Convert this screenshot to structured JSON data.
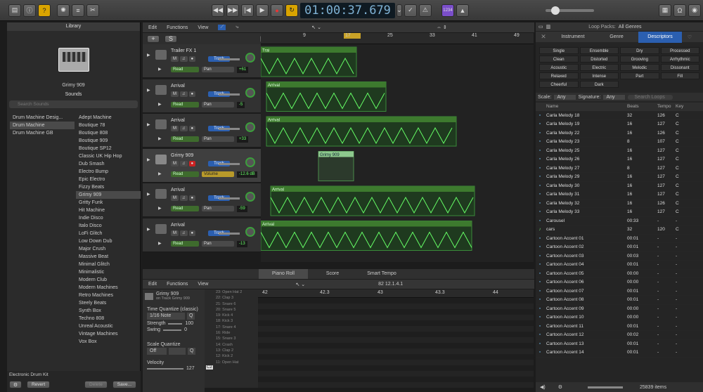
{
  "control_bar": {
    "lcd_time": "01:00:37.679",
    "badge": "1234"
  },
  "library": {
    "title": "Library",
    "patch_name": "Grimy 909",
    "sounds_label": "Sounds",
    "search_placeholder": "Search Sounds",
    "categories": [
      "Drum Machine Desig...",
      "Drum Machine",
      "Drum Machine GB"
    ],
    "patches": [
      "Adept Machine",
      "Boutique 78",
      "Boutique 808",
      "Boutique 909",
      "Boutique SP12",
      "Classic UK Hip Hop",
      "Dub Smash",
      "Electro Bump",
      "Epic Electro",
      "Fizzy Beats",
      "Grimy 909",
      "Gritty Funk",
      "Hit Machine",
      "Indie Disco",
      "Italo Disco",
      "LoFi Glitch",
      "Low Down Dub",
      "Major Crush",
      "Massive Beat",
      "Minimal Glitch",
      "Minimalistic",
      "Modern Club",
      "Modern Machines",
      "Retro Machines",
      "Steely Beats",
      "Synth Box",
      "Techno 808",
      "Unreal Acoustic",
      "Vintage Machines",
      "Vox Box"
    ],
    "footer_kit": "Electronic Drum Kit",
    "revert": "Revert",
    "delete": "Delete",
    "save": "Save..."
  },
  "tracks_menu": {
    "edit": "Edit",
    "functions": "Functions",
    "view": "View"
  },
  "ruler": [
    "9",
    "17",
    "25",
    "33",
    "41",
    "49"
  ],
  "tracks": [
    {
      "name": "Trailer FX 1",
      "mode": "Read",
      "param": "Pan",
      "value": "+61",
      "btn": "Track"
    },
    {
      "name": "Arrival",
      "mode": "Read",
      "param": "Pan",
      "value": "-5",
      "btn": "Track"
    },
    {
      "name": "Arrival",
      "mode": "Read",
      "param": "Pan",
      "value": "+33",
      "btn": "Track"
    },
    {
      "name": "Grimy 909",
      "mode": "Read",
      "param": "Volume",
      "value": "-12.6 dB",
      "btn": "Track"
    },
    {
      "name": "Arrival",
      "mode": "Read",
      "param": "Pan",
      "value": "-59",
      "btn": "Track"
    },
    {
      "name": "Arrival",
      "mode": "Read",
      "param": "Pan",
      "value": "-13",
      "btn": "Track"
    }
  ],
  "regions": {
    "trailer": "Trai",
    "arrival": "Arrival",
    "grimy": "Grimy 909"
  },
  "editor": {
    "tabs": [
      "Piano Roll",
      "Score",
      "Smart Tempo"
    ],
    "edit": "Edit",
    "functions": "Functions",
    "view": "View",
    "position": "82  12.1.4.1",
    "ruler": [
      "42",
      "42.3",
      "43",
      "43.3",
      "44"
    ],
    "region_name": "Grimy 909",
    "region_sub": "on Track Grimy 909",
    "tq_label": "Time Quantize (classic)",
    "tq_value": "1/16 Note",
    "q": "Q",
    "strength_label": "Strength",
    "strength_value": "100",
    "swing_label": "Swing",
    "swing_value": "0",
    "sq_label": "Scale Quantize",
    "sq_value": "Off",
    "velocity_label": "Velocity",
    "velocity_value": "127",
    "keys": [
      "23: Open Hat 2",
      "22: Clap 3",
      "21: Snare 6",
      "20: Snare 5",
      "19: Kick 4",
      "18: Kick 3",
      "17: Snare 4",
      "16: Ride",
      "15: Snare 3",
      "14: Crash",
      "13: Clap 2",
      "12: Kick 2",
      "11: Open Hat"
    ],
    "c2": "C2"
  },
  "loops": {
    "packs_label": "Loop Packs:",
    "packs_value": "All Genres",
    "tabs": [
      "Instrument",
      "Genre",
      "Descriptors"
    ],
    "descriptors": [
      [
        "Single",
        "Ensemble",
        "Dry",
        "Processed"
      ],
      [
        "Clean",
        "Distorted",
        "Grooving",
        "Arrhythmic"
      ],
      [
        "Acoustic",
        "Electric",
        "Melodic",
        "Dissonant"
      ],
      [
        "Relaxed",
        "Intense",
        "Part",
        "Fill"
      ],
      [
        "Cheerful",
        "Dark",
        "",
        ""
      ]
    ],
    "scale_label": "Scale:",
    "scale_value": "Any",
    "signature_label": "Signature:",
    "signature_value": "Any",
    "search_placeholder": "Search Loops",
    "columns": [
      "Name",
      "Beats",
      "Tempo",
      "Key"
    ],
    "rows": [
      [
        "Carla Melody 18",
        "32",
        "126",
        "C"
      ],
      [
        "Carla Melody 19",
        "16",
        "127",
        "C"
      ],
      [
        "Carla Melody 22",
        "16",
        "126",
        "C"
      ],
      [
        "Carla Melody 23",
        "8",
        "107",
        "C"
      ],
      [
        "Carla Melody 25",
        "16",
        "127",
        "C"
      ],
      [
        "Carla Melody 26",
        "16",
        "127",
        "C"
      ],
      [
        "Carla Melody 27",
        "8",
        "127",
        "C"
      ],
      [
        "Carla Melody 29",
        "16",
        "127",
        "C"
      ],
      [
        "Carla Melody 30",
        "16",
        "127",
        "C"
      ],
      [
        "Carla Melody 31",
        "16",
        "127",
        "C"
      ],
      [
        "Carla Melody 32",
        "16",
        "126",
        "C"
      ],
      [
        "Carla Melody 33",
        "16",
        "127",
        "C"
      ],
      [
        "Carousel",
        "00:33",
        "-",
        "-"
      ],
      [
        "cars",
        "32",
        "120",
        "C"
      ],
      [
        "Cartoon Accent 01",
        "00:01",
        "-",
        "-"
      ],
      [
        "Cartoon Accent 02",
        "00:01",
        "-",
        "-"
      ],
      [
        "Cartoon Accent 03",
        "00:03",
        "-",
        "-"
      ],
      [
        "Cartoon Accent 04",
        "00:01",
        "-",
        "-"
      ],
      [
        "Cartoon Accent 05",
        "00:00",
        "-",
        "-"
      ],
      [
        "Cartoon Accent 06",
        "00:00",
        "-",
        "-"
      ],
      [
        "Cartoon Accent 07",
        "00:01",
        "-",
        "-"
      ],
      [
        "Cartoon Accent 08",
        "00:01",
        "-",
        "-"
      ],
      [
        "Cartoon Accent 09",
        "00:00",
        "-",
        "-"
      ],
      [
        "Cartoon Accent 10",
        "00:00",
        "-",
        "-"
      ],
      [
        "Cartoon Accent 11",
        "00:01",
        "-",
        "-"
      ],
      [
        "Cartoon Accent 12",
        "00:02",
        "-",
        "-"
      ],
      [
        "Cartoon Accent 13",
        "00:01",
        "-",
        "-"
      ],
      [
        "Cartoon Accent 14",
        "00:01",
        "-",
        "-"
      ]
    ],
    "item_count": "25839 items"
  }
}
